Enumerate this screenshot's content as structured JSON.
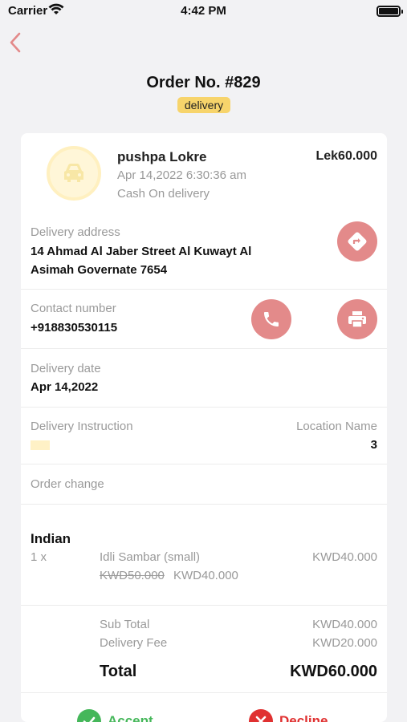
{
  "status_bar": {
    "carrier": "Carrier",
    "time": "4:42 PM"
  },
  "header": {
    "title": "Order No. #829",
    "badge": "delivery"
  },
  "customer": {
    "name": "pushpa Lokre",
    "amount": "Lek60.000",
    "datetime": "Apr 14,2022 6:30:36 am",
    "payment_method": "Cash On delivery"
  },
  "delivery_address": {
    "label": "Delivery address",
    "line1": "14 Ahmad Al Jaber Street Al Kuwayt Al",
    "line2": "Asimah Governate 7654"
  },
  "contact": {
    "label": "Contact number",
    "value": "+918830530115"
  },
  "delivery_date": {
    "label": "Delivery date",
    "value": "Apr 14,2022"
  },
  "instruction": {
    "label": "Delivery Instruction",
    "location_label": "Location Name",
    "location_value": "3"
  },
  "order_change": {
    "label": "Order change"
  },
  "items": {
    "category": "Indian",
    "qty": "1 x",
    "name": "Idli Sambar (small)",
    "price": "KWD40.000",
    "old_price": "KWD50.000",
    "new_price": "KWD40.000"
  },
  "summary": {
    "subtotal_label": "Sub Total",
    "subtotal": "KWD40.000",
    "fee_label": "Delivery Fee",
    "fee": "KWD20.000",
    "total_label": "Total",
    "total": "KWD60.000"
  },
  "actions": {
    "accept": "Accept",
    "decline": "Decline"
  },
  "colors": {
    "accent_red": "#e38a8a",
    "badge_yellow": "#f7d46b",
    "accept_green": "#45b75a",
    "decline_red": "#e03131"
  },
  "icons": {
    "back": "chevron-left-icon",
    "avatar": "car-icon",
    "directions": "directions-icon",
    "phone": "phone-icon",
    "print": "printer-icon",
    "accept": "check-icon",
    "decline": "x-icon"
  }
}
